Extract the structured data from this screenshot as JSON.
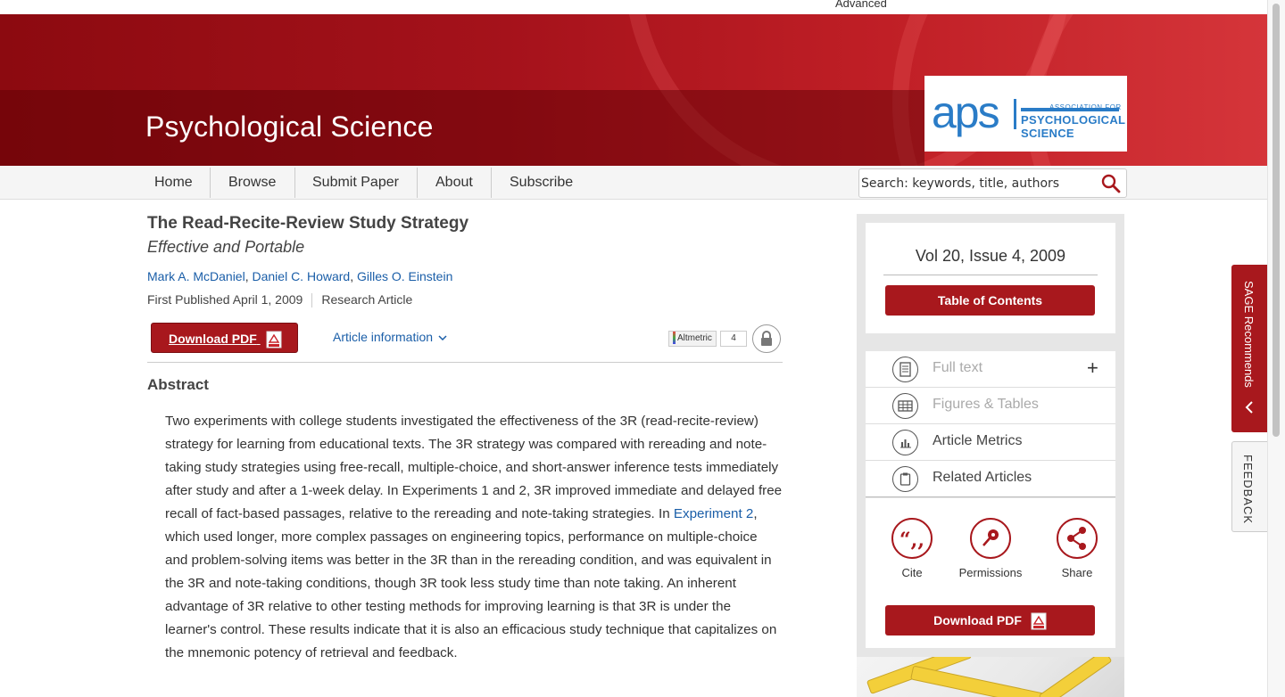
{
  "top": {
    "advanced_label": "Advanced"
  },
  "header": {
    "journal_title": "Psychological Science"
  },
  "logo": {
    "mark": "aps",
    "line1": "ASSOCIATION FOR",
    "line2": "PSYCHOLOGICAL SCIENCE"
  },
  "nav": {
    "items": [
      "Home",
      "Browse",
      "Submit Paper",
      "About",
      "Subscribe"
    ]
  },
  "search": {
    "placeholder": "Search: keywords, title, authors",
    "icon": "search-icon"
  },
  "article": {
    "title": "The Read-Recite-Review Study Strategy",
    "subtitle": "Effective and Portable",
    "authors": [
      "Mark A. McDaniel",
      "Daniel C. Howard",
      "Gilles O. Einstein"
    ],
    "first_published": "First Published April 1, 2009",
    "type": "Research Article"
  },
  "tools": {
    "download_pdf": "Download PDF",
    "article_info": "Article information",
    "altmetric_label": "Altmetric",
    "altmetric_count": "4"
  },
  "abstract": {
    "heading": "Abstract",
    "text_before_link": "Two experiments with college students investigated the effectiveness of the 3R (read-recite-review) strategy for learning from educational texts. The 3R strategy was compared with rereading and note-taking study strategies using free-recall, multiple-choice, and short-answer inference tests immediately after study and after a 1-week delay. In Experiments 1 and 2, 3R improved immediate and delayed free recall of fact-based passages, relative to the rereading and note-taking strategies. In ",
    "link": "Experiment 2",
    "text_after_link": ", which used longer, more complex passages on engineering topics, performance on multiple-choice and problem-solving items was better in the 3R than in the rereading condition, and was equivalent in the 3R and note-taking conditions, though 3R took less study time than note taking. An inherent advantage of 3R relative to other testing methods for improving learning is that 3R is under the learner's control. These results indicate that it is also an efficacious study technique that capitalizes on the mnemonic potency of retrieval and feedback."
  },
  "sidebar": {
    "issue": "Vol 20, Issue 4, 2009",
    "toc_button": "Table of Contents",
    "items": [
      {
        "label": "Full text",
        "icon": "document-icon",
        "disabled": true,
        "expand": "+"
      },
      {
        "label": "Figures & Tables",
        "icon": "table-icon",
        "disabled": true
      },
      {
        "label": "Article Metrics",
        "icon": "bar-chart-icon",
        "disabled": false
      },
      {
        "label": "Related Articles",
        "icon": "clipboard-icon",
        "disabled": false
      }
    ],
    "actions": [
      {
        "label": "Cite",
        "icon": "quote-icon"
      },
      {
        "label": "Permissions",
        "icon": "key-icon"
      },
      {
        "label": "Share",
        "icon": "share-icon"
      }
    ],
    "download_pdf": "Download PDF"
  },
  "side_tabs": {
    "sage": "SAGE Recommends",
    "feedback": "FEEDBACK"
  },
  "colors": {
    "brand_red": "#a8181d",
    "link_blue": "#1a5ea8",
    "aps_blue": "#2a7cc7"
  }
}
